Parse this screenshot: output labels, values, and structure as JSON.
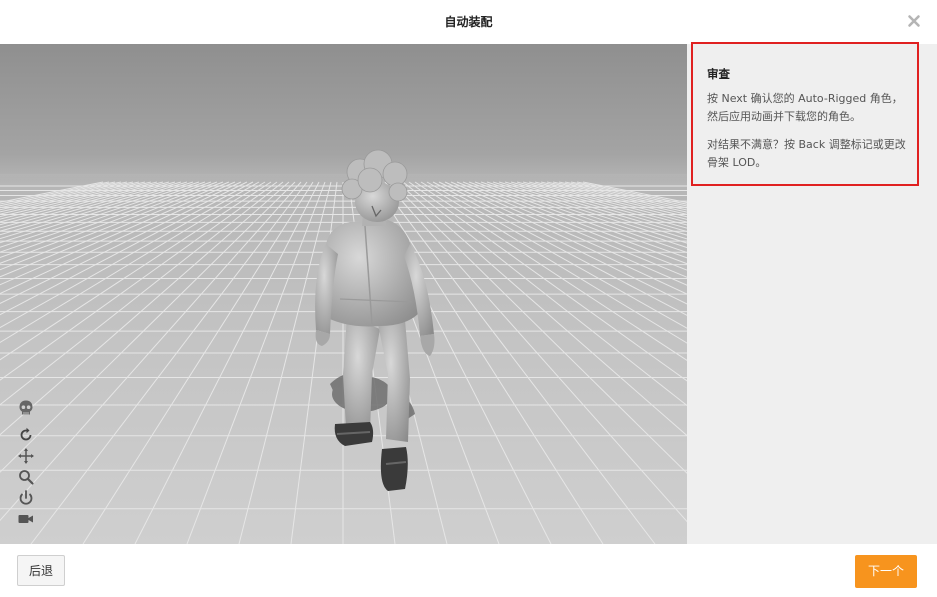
{
  "header": {
    "title": "自动装配",
    "close_icon": "close-icon"
  },
  "review": {
    "title": "审查",
    "paragraph1": "按 Next 确认您的 Auto-Rigged 角色，然后应用动画并下载您的角色。",
    "paragraph2": "对结果不满意？按 Back 调整标记或更改骨架 LOD。",
    "border_color": "#e02020"
  },
  "toolbar": {
    "icons": [
      "skeleton-icon",
      "rotate-icon",
      "pan-icon",
      "zoom-icon",
      "power-icon",
      "camera-icon"
    ]
  },
  "footer": {
    "back_label": "后退",
    "next_label": "下一个",
    "next_color": "#f7941e"
  }
}
